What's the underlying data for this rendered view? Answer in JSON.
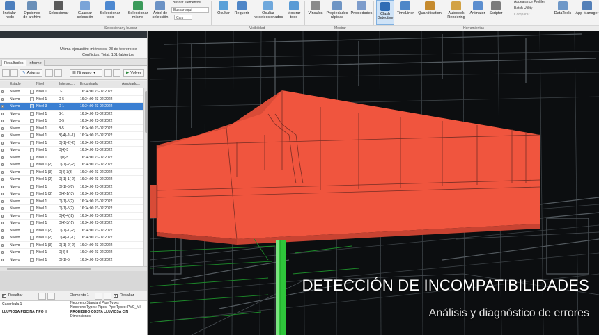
{
  "ribbon": {
    "buttons": [
      {
        "label": "Instalar\nnodo",
        "icon": "install-icon",
        "color": "#4d7fbd"
      },
      {
        "label": "Opciones\nde archivo",
        "icon": "file-options-icon",
        "color": "#6a8fb8"
      },
      {
        "label": "Seleccionar",
        "icon": "select-cursor-icon",
        "color": "#5a5a5a"
      },
      {
        "label": "Guardar\nselección",
        "icon": "save-selection-icon",
        "color": "#7aa4d8"
      },
      {
        "label": "Seleccionar\ntodo",
        "icon": "select-all-icon",
        "color": "#4d88d0"
      },
      {
        "label": "Seleccionar\nmismo",
        "icon": "select-same-icon",
        "color": "#3b9a5a"
      },
      {
        "label": "Árbol de\nselección",
        "icon": "selection-tree-icon",
        "color": "#6b92c5"
      },
      {
        "label": "Ocultar",
        "icon": "hide-icon",
        "color": "#5aa0d8"
      },
      {
        "label": "Requerir",
        "icon": "require-icon",
        "color": "#4f86c7"
      },
      {
        "label": "Ocultar\nno seleccionados",
        "icon": "hide-unselected-icon",
        "color": "#6fa8dc"
      },
      {
        "label": "Mostrar\ntodo",
        "icon": "show-all-icon",
        "color": "#5a9bd5"
      },
      {
        "label": "Vínculos",
        "icon": "links-icon",
        "color": "#8a8a8a"
      },
      {
        "label": "Propiedades\nrápidas",
        "icon": "quick-properties-icon",
        "color": "#6f95c4"
      },
      {
        "label": "Propiedades",
        "icon": "properties-icon",
        "color": "#7d9ccb"
      },
      {
        "label": "Clash\nDetective",
        "icon": "clash-detective-icon",
        "color": "#2f6db5"
      },
      {
        "label": "TimeLiner",
        "icon": "timeliner-icon",
        "color": "#4e87c8"
      },
      {
        "label": "Quantification",
        "icon": "quantification-icon",
        "color": "#c58a2e"
      },
      {
        "label": "Autodesk\nRendering",
        "icon": "rendering-icon",
        "color": "#d2a245"
      },
      {
        "label": "Animator",
        "icon": "animator-icon",
        "color": "#5b8ecf"
      },
      {
        "label": "Scripter",
        "icon": "scripter-icon",
        "color": "#7c7c7c"
      },
      {
        "label": "DataTools",
        "icon": "datatools-icon",
        "color": "#6f98c8"
      },
      {
        "label": "App Manager",
        "icon": "app-manager-icon",
        "color": "#5480b8"
      }
    ],
    "search_label": "Buscar elementos",
    "find_placeholder": "Buscar aquí",
    "query_value": "Cary",
    "appearance_profiler": "Appearance Profiler",
    "batch_utility": "Batch Utility",
    "compare": "Comparar",
    "groups": {
      "select_search": "Seleccionar y buscar",
      "visibility": "Visibilidad",
      "display": "Mostrar",
      "tools": "Herramientas"
    }
  },
  "panel": {
    "last_run": "Última ejecución: miércoles, 23 de febrero de",
    "conflicts": "Conflictos: Total: 101 (abiertos:",
    "tabs": [
      "Resultados",
      "Informe"
    ],
    "assign_label": "Asignar",
    "group_label": "Ninguno",
    "review_label": "Volver",
    "columns": [
      "Estado",
      "Nivel",
      "Intersec...",
      "Encontrado",
      "Aprobado..."
    ],
    "rows": [
      {
        "status": "Nuevo",
        "level": "Nivel 1",
        "grid": "D-1",
        "found": "16:34:00 23-02-2022",
        "selected": false
      },
      {
        "status": "Nuevo",
        "level": "Nivel 1",
        "grid": "D-5",
        "found": "16:34:00 23-02-2022",
        "selected": false
      },
      {
        "status": "Nuevo",
        "level": "Nivel 3",
        "grid": "D-1",
        "found": "16:34:00 23-02-2022",
        "selected": true
      },
      {
        "status": "Nuevo",
        "level": "Nivel 1",
        "grid": "B-1",
        "found": "16:34:00 23-02-2022",
        "selected": false
      },
      {
        "status": "Nuevo",
        "level": "Nivel 1",
        "grid": "D-5",
        "found": "16:34:00 23-02-2022",
        "selected": false
      },
      {
        "status": "Nuevo",
        "level": "Nivel 1",
        "grid": "B-5",
        "found": "16:34:00 23-02-2022",
        "selected": false
      },
      {
        "status": "Nuevo",
        "level": "Nivel 1",
        "grid": "B(-4)-2(-1)",
        "found": "16:34:00 23-02-2022",
        "selected": false
      },
      {
        "status": "Nuevo",
        "level": "Nivel 1",
        "grid": "D(-1)-2(-2)",
        "found": "16:34:00 23-02-2022",
        "selected": false
      },
      {
        "status": "Nuevo",
        "level": "Nivel 1",
        "grid": "D(4)-5",
        "found": "16:34:00 23-02-2022",
        "selected": false
      },
      {
        "status": "Nuevo",
        "level": "Nivel 1",
        "grid": "D(0)-5",
        "found": "16:34:00 23-02-2022",
        "selected": false
      },
      {
        "status": "Nuevo",
        "level": "Nivel 1 (2)",
        "grid": "D(-1)-2(-2)",
        "found": "16:34:00 23-02-2022",
        "selected": false
      },
      {
        "status": "Nuevo",
        "level": "Nivel 1 (3)",
        "grid": "D(4)-3(3)",
        "found": "16:34:00 23-02-2022",
        "selected": false
      },
      {
        "status": "Nuevo",
        "level": "Nivel 1 (2)",
        "grid": "D(-1)-1(-2)",
        "found": "16:34:00 23-02-2022",
        "selected": false
      },
      {
        "status": "Nuevo",
        "level": "Nivel 1",
        "grid": "D(-1)-5(0)",
        "found": "16:34:00 23-02-2022",
        "selected": false
      },
      {
        "status": "Nuevo",
        "level": "Nivel 1 (3)",
        "grid": "D(4)-1(-3)",
        "found": "16:34:00 23-02-2022",
        "selected": false
      },
      {
        "status": "Nuevo",
        "level": "Nivel 1",
        "grid": "D(-1)-5(2)",
        "found": "16:34:00 23-02-2022",
        "selected": false
      },
      {
        "status": "Nuevo",
        "level": "Nivel 1",
        "grid": "D(-1)-5(2)",
        "found": "16:34:00 23-02-2022",
        "selected": false
      },
      {
        "status": "Nuevo",
        "level": "Nivel 1",
        "grid": "D(4)-4(-2)",
        "found": "16:34:00 23-02-2022",
        "selected": false
      },
      {
        "status": "Nuevo",
        "level": "Nivel 1",
        "grid": "D(4)-3(-1)",
        "found": "16:34:00 23-02-2022",
        "selected": false
      },
      {
        "status": "Nuevo",
        "level": "Nivel 1 (2)",
        "grid": "D(-1)-1(-2)",
        "found": "16:34:00 23-02-2022",
        "selected": false
      },
      {
        "status": "Nuevo",
        "level": "Nivel 1 (2)",
        "grid": "D(-4)-1(-1)",
        "found": "16:34:00 23-02-2022",
        "selected": false
      },
      {
        "status": "Nuevo",
        "level": "Nivel 1 (3)",
        "grid": "D(-1)-2(-2)",
        "found": "16:34:00 23-02-2022",
        "selected": false
      },
      {
        "status": "Nuevo",
        "level": "Nivel 1",
        "grid": "D(4)-5",
        "found": "16:34:00 23-02-2022",
        "selected": false
      },
      {
        "status": "Nuevo",
        "level": "Nivel 1",
        "grid": "D(-1)-5",
        "found": "16:34:00 23-02-2022",
        "selected": false
      }
    ],
    "bottom": {
      "highlight_left": "Resaltar",
      "element_1": "Elemento 1",
      "highlight_right": "Resaltar",
      "left_line1": "Cuadrícula 1",
      "left_line2": "LLUVIOSA PISCINA TIPO II",
      "right_line1": "Neopreno Standard Pipe Types",
      "right_line2": "Neopreno Types: Pipes: Pipe Types: PVC_MI",
      "right_line3": "PROHIBIDO COSTA LLUVIOSA CIN",
      "right_line4": "Dimensiones"
    }
  },
  "overlay": {
    "title": "DETECCIÓN DE INCOMPATIBILIDADES",
    "subtitle": "Análisis y diagnóstico  de errores"
  },
  "colors": {
    "clash_red": "#f0553e",
    "clash_red_dark": "#c84332",
    "pipe_green": "#2ec53a",
    "grid_green": "#1d8a2a",
    "selection_blue": "#3a7fd2"
  }
}
